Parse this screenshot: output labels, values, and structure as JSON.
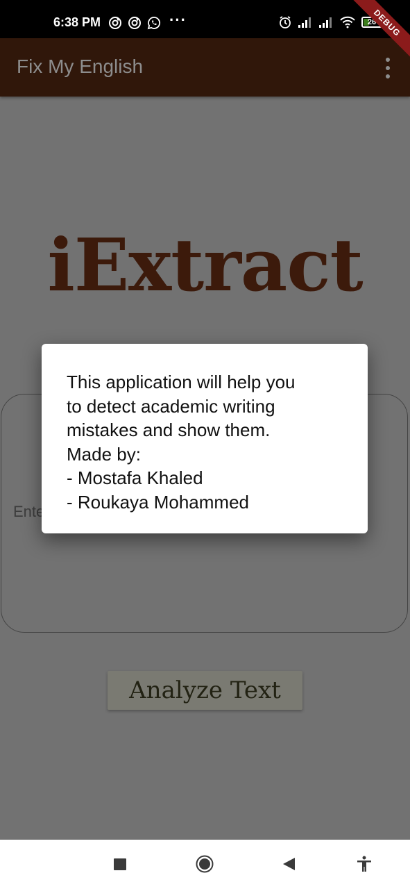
{
  "status_bar": {
    "time": "6:38 PM",
    "more": "···",
    "battery": "26"
  },
  "debug_banner": "DEBUG",
  "app_bar": {
    "title": "Fix My English"
  },
  "logo": "iExtract",
  "input": {
    "placeholder": "Ente"
  },
  "analyze_button": "Analyze Text",
  "dialog": {
    "lines": [
      "This application will help you",
      "to detect academic writing",
      "mistakes and show them.",
      "Made by:",
      "- Mostafa Khaled",
      "- Roukaya Mohammed"
    ]
  },
  "colors": {
    "app_bar_bg": "#30170a",
    "logo": "#3c1a0b",
    "scrim_bg": "#727272",
    "debug_ribbon": "#8b1b1b"
  },
  "icons": {
    "status_left": [
      "sync-icon",
      "sync-icon",
      "whatsapp-icon"
    ],
    "status_right": [
      "alarm-icon",
      "signal-icon",
      "signal-icon",
      "wifi-icon",
      "battery-icon"
    ],
    "nav": [
      "recents-icon",
      "home-icon",
      "back-icon",
      "accessibility-icon"
    ]
  }
}
